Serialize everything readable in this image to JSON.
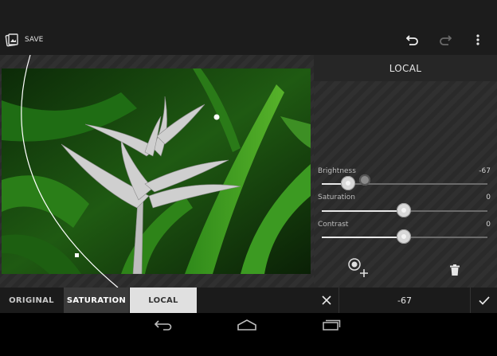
{
  "toolbar": {
    "save_label": "SAVE",
    "icons": [
      "save-photo-icon",
      "undo-icon",
      "redo-icon",
      "overflow-menu-icon"
    ]
  },
  "panel": {
    "title": "LOCAL",
    "sliders": [
      {
        "label": "Brightness",
        "value": "-67",
        "level": 0.17
      },
      {
        "label": "Saturation",
        "value": "0",
        "level": 0.5
      },
      {
        "label": "Contrast",
        "value": "0",
        "level": 0.5
      }
    ],
    "add_point_icon": "add-control-point-icon",
    "delete_icon": "trash-icon"
  },
  "tabs": [
    {
      "label": "ORIGINAL",
      "state": "normal"
    },
    {
      "label": "SATURATION",
      "state": "dark-selected"
    },
    {
      "label": "LOCAL",
      "state": "selected"
    }
  ],
  "bottom": {
    "cancel_icon": "close-icon",
    "current_value": "-67",
    "apply_icon": "checkmark-icon"
  },
  "nav": {
    "icons": [
      "back-icon",
      "home-icon",
      "recent-apps-icon"
    ]
  },
  "colors": {
    "panel_bg": "#2c2c2c",
    "selected_tab_bg": "#e0e0e0",
    "accent_text": "#ffffff"
  }
}
